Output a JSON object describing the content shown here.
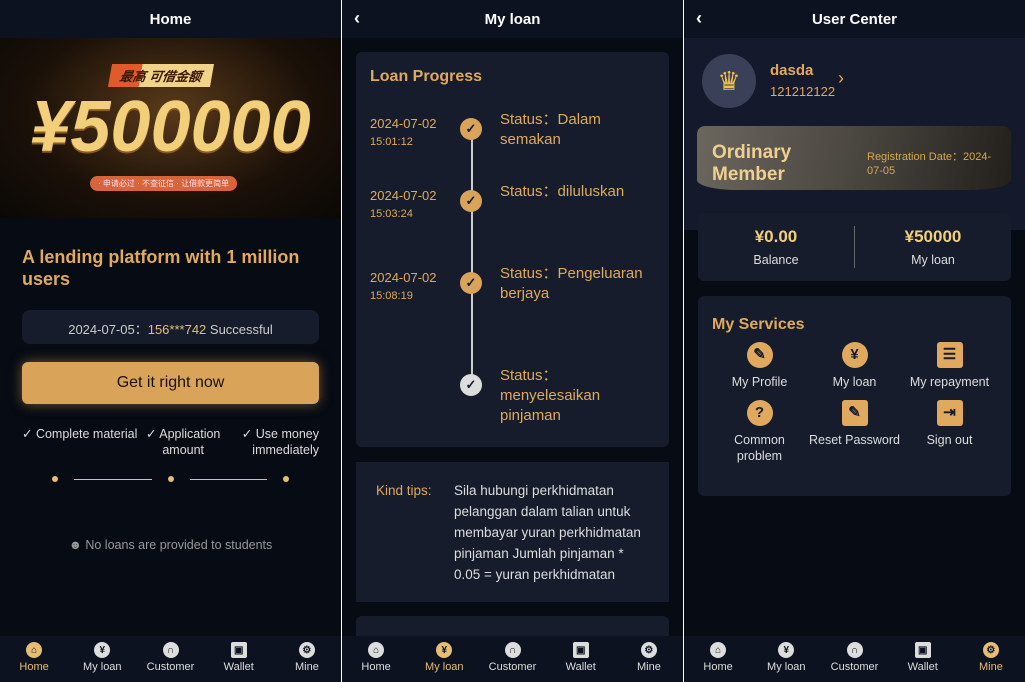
{
  "colors": {
    "accent": "#e0a95d",
    "background": "#070b14",
    "card": "#161c2b"
  },
  "tabbar": [
    {
      "label": "Home",
      "icon": "home-icon"
    },
    {
      "label": "My loan",
      "icon": "yen-icon"
    },
    {
      "label": "Customer",
      "icon": "headset-icon"
    },
    {
      "label": "Wallet",
      "icon": "wallet-icon"
    },
    {
      "label": "Mine",
      "icon": "gear-icon"
    }
  ],
  "home": {
    "title": "Home",
    "banner": {
      "tag": "最高 可借金额",
      "amount": "¥500000",
      "pill": "· 申请必过 · 不查征信 · 让借款更简单"
    },
    "slogan": "A lending platform with 1 million users",
    "notice_date": "2024-07-05：",
    "notice_phone": "156***742",
    "notice_text": " Successful",
    "cta": "Get it right now",
    "features": [
      "Complete material",
      "Application amount",
      "Use money immediately"
    ],
    "student_note": "No loans are provided to students",
    "active_tab": 0
  },
  "loan": {
    "title": "My loan",
    "progress_title": "Loan Progress",
    "steps": [
      {
        "date": "2024-07-02",
        "time": "15:01:12",
        "status": "Status：Dalam semakan",
        "done": true
      },
      {
        "date": "2024-07-02",
        "time": "15:03:24",
        "status": "Status：diluluskan",
        "done": true
      },
      {
        "date": "2024-07-02",
        "time": "15:08:19",
        "status": "Status：Pengeluaran berjaya",
        "done": true
      },
      {
        "date": "",
        "time": "",
        "status": "Status：menyelesaikan pinjaman",
        "done": false
      }
    ],
    "tips_label": "Kind tips:",
    "tips_text": "Sila hubungi perkhidmatan pelanggan dalam talian untuk membayar yuran perkhidmatan pinjaman Jumlah pinjaman * 0.05 = yuran perkhidmatan",
    "active_tab": 1
  },
  "user": {
    "title": "User Center",
    "name": "dasda",
    "id": "121212122",
    "member": "Ordinary Member",
    "reg_date": "Registration Date：2024-07-05",
    "balance": "¥0.00",
    "balance_label": "Balance",
    "loan": "¥50000",
    "loan_label": "My loan",
    "services_title": "My Services",
    "services": [
      {
        "label": "My Profile",
        "icon": "profile-icon"
      },
      {
        "label": "My loan",
        "icon": "yen-icon"
      },
      {
        "label": "My repayment",
        "icon": "repayment-icon"
      },
      {
        "label": "Common problem",
        "icon": "question-icon"
      },
      {
        "label": "Reset Password",
        "icon": "edit-icon"
      },
      {
        "label": "Sign out",
        "icon": "sign-out-icon"
      }
    ],
    "active_tab": 4
  }
}
